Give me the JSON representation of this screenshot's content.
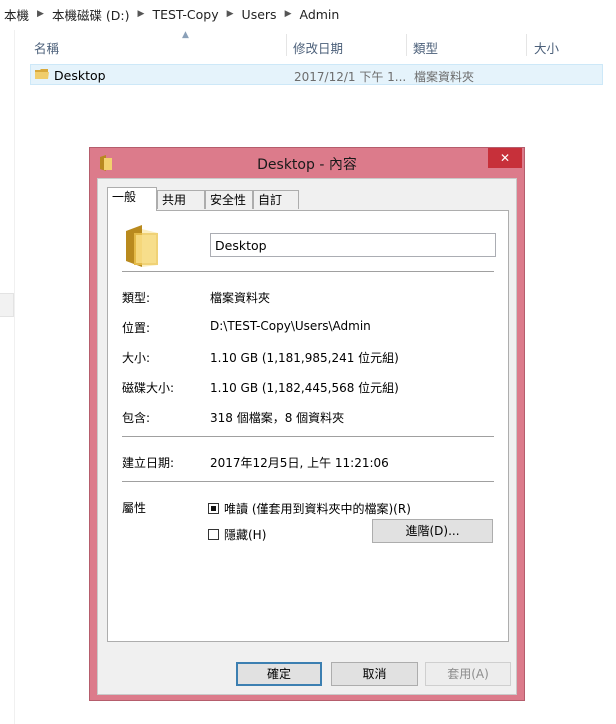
{
  "breadcrumb": [
    "本機",
    "本機磁碟 (D:)",
    "TEST-Copy",
    "Users",
    "Admin"
  ],
  "columns": {
    "name": "名稱",
    "modified": "修改日期",
    "type": "類型",
    "size": "大小"
  },
  "file_row": {
    "name": "Desktop",
    "modified": "2017/12/1 下午 1...",
    "type": "檔案資料夾"
  },
  "dialog": {
    "title": "Desktop - 內容",
    "close_glyph": "✕",
    "tabs": [
      "一般",
      "共用",
      "安全性",
      "自訂"
    ],
    "folder_name": "Desktop",
    "props": {
      "type_label": "類型:",
      "type_value": "檔案資料夾",
      "location_label": "位置:",
      "location_value": "D:\\TEST-Copy\\Users\\Admin",
      "size_label": "大小:",
      "size_value": "1.10 GB (1,181,985,241 位元組)",
      "disk_size_label": "磁碟大小:",
      "disk_size_value": "1.10 GB (1,182,445,568 位元組)",
      "contains_label": "包含:",
      "contains_value": "318 個檔案，8 個資料夾",
      "created_label": "建立日期:",
      "created_value": "2017年12月5日, 上午 11:21:06",
      "attributes_label": "屬性"
    },
    "readonly_label": "唯讀 (僅套用到資料夾中的檔案)(R)",
    "readonly_state": "indeterminate",
    "hidden_label": "隱藏(H)",
    "hidden_state": "unchecked",
    "advanced_button": "進階(D)...",
    "ok_button": "確定",
    "cancel_button": "取消",
    "apply_button": "套用(A)"
  },
  "colors": {
    "dialog_frame": "#dc7b8b",
    "close_button": "#c7303a",
    "selected_row": "#e5f3fb",
    "header_text": "#4c607a",
    "folder_yellow": "#e8c25a"
  }
}
